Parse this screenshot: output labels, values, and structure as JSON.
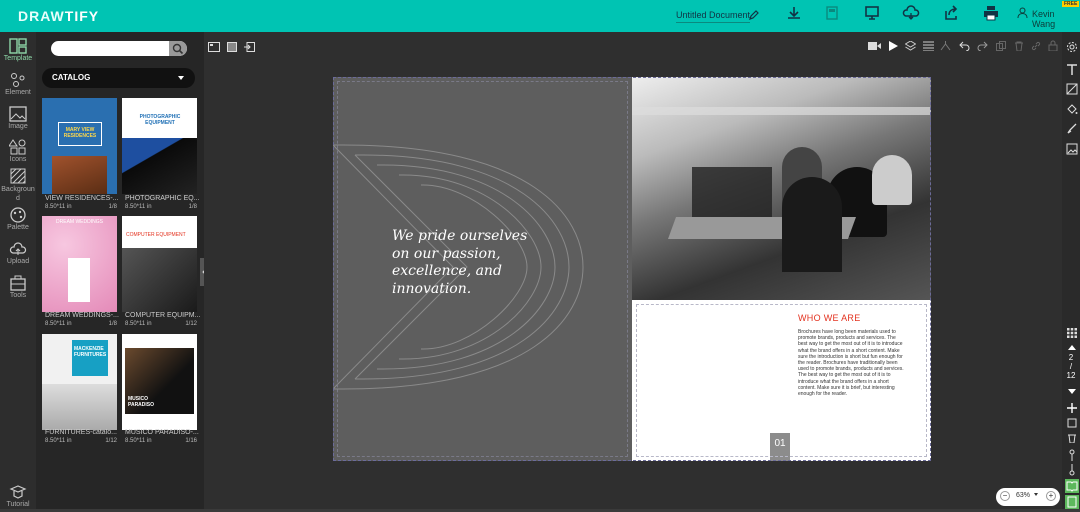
{
  "app": {
    "logo_main": "DRAW",
    "logo_accent": "TIFY"
  },
  "header": {
    "document_title": "Untitled Document",
    "user_name": "Kevin Wang",
    "free_badge": "FREE",
    "toolbar_icons": [
      "download-icon",
      "save-icon",
      "present-icon",
      "cloud-icon",
      "share-icon",
      "print-icon"
    ]
  },
  "sidebar": {
    "items": [
      {
        "label": "Template",
        "icon": "template-icon",
        "active": true
      },
      {
        "label": "Element",
        "icon": "element-icon"
      },
      {
        "label": "Image",
        "icon": "image-icon"
      },
      {
        "label": "Icons",
        "icon": "icons-icon"
      },
      {
        "label": "Backgroun d",
        "icon": "background-icon"
      },
      {
        "label": "Palette",
        "icon": "palette-icon"
      },
      {
        "label": "Upload",
        "icon": "upload-icon"
      },
      {
        "label": "Tools",
        "icon": "tools-icon"
      }
    ],
    "tutorial_label": "Tutorial"
  },
  "panel": {
    "search_placeholder": "",
    "catalog_label": "CATALOG",
    "templates": [
      {
        "name": "VIEW RESIDENCES-...",
        "size": "8.50*11 in",
        "pages": "1/8",
        "cover_title": "MARY VIEW RESIDENCES"
      },
      {
        "name": "PHOTOGRAPHIC EQ...",
        "size": "8.50*11 in",
        "pages": "1/8",
        "cover_title": "PHOTOGRAPHIC EQUIPMENT"
      },
      {
        "name": "DREAM WEDDINGS-...",
        "size": "8.50*11 in",
        "pages": "1/8",
        "cover_title": "DREAM WEDDINGS"
      },
      {
        "name": "COMPUTER EQUIPM...",
        "size": "8.50*11 in",
        "pages": "1/12",
        "cover_title": "COMPUTER EQUIPMENT"
      },
      {
        "name": "FURNITURES-catalo...",
        "size": "8.50*11 in",
        "pages": "1/12",
        "cover_title": "MACKENZIE FURNITURES"
      },
      {
        "name": "MUSICO PARADISO-...",
        "size": "8.50*11 in",
        "pages": "1/16",
        "cover_title": "MUSICO PARADISO"
      }
    ]
  },
  "document": {
    "slogan": "We pride ourselves on our passion, excellence, and innovation.",
    "heading": "WHO WE ARE",
    "body": "Brochures have long been materials used to promote brands, products and services. The best way to get the most out of it is to introduce what the brand offers in a short content. Make sure the introduction is short but fun enough for the reader. Brochures have traditionally been used to promote brands, products and services. The best way to get the most out of it is to introduce what the brand offers in a short content. Make sure it is brief, but interesting enough for the reader.",
    "page_number": "01"
  },
  "pager": {
    "current": "2",
    "separator": "/",
    "total": "12"
  },
  "zoom": {
    "value": "63%",
    "minus": "−",
    "plus": "+"
  },
  "colors": {
    "brand": "#00c4b3",
    "accent_red": "#e3321f"
  }
}
